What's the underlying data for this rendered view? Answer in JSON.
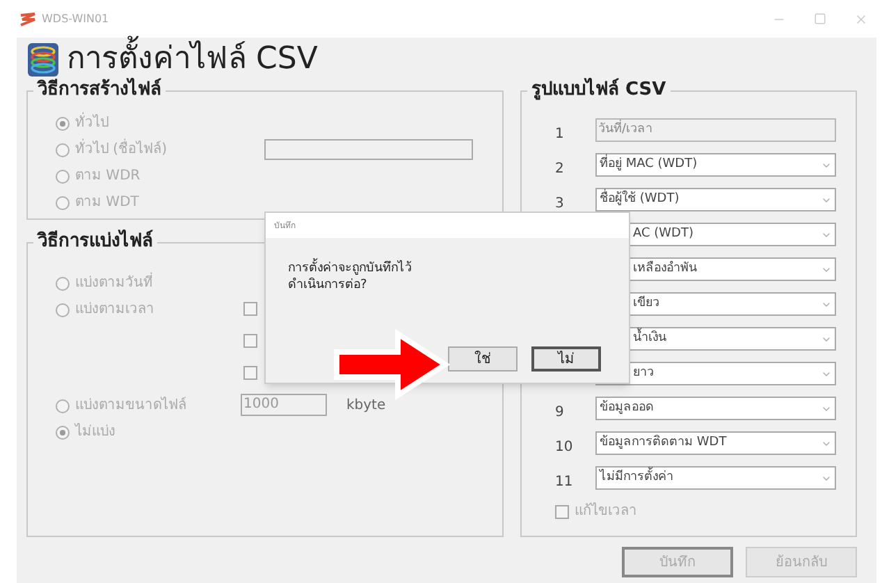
{
  "window": {
    "title": "WDS-WIN01"
  },
  "header": {
    "title": "การตั้งค่าไฟล์ CSV"
  },
  "creation_method": {
    "title": "วิธีการสร้างไฟล์",
    "options": [
      {
        "label": "ทั่วไป",
        "selected": true
      },
      {
        "label": "ทั่วไป (ชื่อไฟล์)",
        "selected": false
      },
      {
        "label": "ตาม WDR",
        "selected": false
      },
      {
        "label": "ตาม WDT",
        "selected": false
      }
    ]
  },
  "split_method": {
    "title": "วิธีการแบ่งไฟล์",
    "options": [
      {
        "label": "แบ่งตามวันที่",
        "selected": false,
        "kind": "plain"
      },
      {
        "label": "แบ่งตามเวลา",
        "selected": false,
        "kind": "time"
      },
      {
        "label": "แบ่งตามขนาดไฟล์",
        "selected": false,
        "kind": "size"
      },
      {
        "label": "ไม่แบ่ง",
        "selected": true,
        "kind": "plain"
      }
    ],
    "time_checks": [
      {
        "checked": false
      },
      {
        "checked": false
      },
      {
        "checked": false
      }
    ],
    "size_field": {
      "value": "1000",
      "unit": "kbyte"
    }
  },
  "csv_format": {
    "title": "รูปแบบไฟล์ CSV",
    "rows": [
      {
        "number": "1",
        "value": "วันที่/เวลา",
        "kind": "text"
      },
      {
        "number": "2",
        "value": "ที่อยู่ MAC (WDT)",
        "kind": "combo"
      },
      {
        "number": "3",
        "value": "ชื่อผู้ใช้ (WDT)",
        "kind": "combo"
      },
      {
        "value": "AC (WDT)",
        "kind": "covered"
      },
      {
        "value": "เหลืองอำพัน",
        "kind": "covered"
      },
      {
        "value": "เขียว",
        "kind": "covered"
      },
      {
        "value": "น้ำเงิน",
        "kind": "covered"
      },
      {
        "value": "ยาว",
        "kind": "covered"
      },
      {
        "number": "9",
        "value": "ข้อมูลออด",
        "kind": "combo"
      },
      {
        "number": "10",
        "value": "ข้อมูลการติดตาม WDT",
        "kind": "combo"
      },
      {
        "number": "11",
        "value": "ไม่มีการตั้งค่า",
        "kind": "combo"
      }
    ],
    "fix_time": {
      "label": "แก้ไขเวลา",
      "checked": false
    }
  },
  "buttons": [
    {
      "label": "บันทึก"
    },
    {
      "label": "ย้อนกลับ"
    }
  ],
  "dialog": {
    "title": "บันทึก",
    "message": "การตั้งค่าจะถูกบันทึกไว้\n ดำเนินการต่อ?",
    "buttons": [
      {
        "label": "ใช่"
      },
      {
        "label": "ไม่"
      }
    ]
  }
}
